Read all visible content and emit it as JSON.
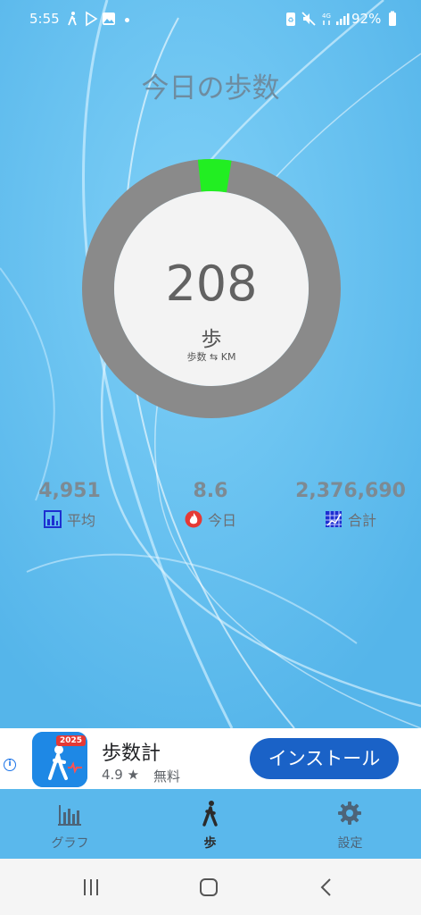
{
  "status_bar": {
    "time": "5:55",
    "battery": "92%",
    "icons": [
      "walk-icon",
      "play-store-icon",
      "gallery-icon",
      "battery-saver-icon",
      "mute-icon",
      "4g-icon",
      "signal-icon",
      "battery-icon"
    ]
  },
  "header": {
    "title": "今日の歩数"
  },
  "ring": {
    "steps": "208",
    "unit": "歩",
    "toggle": "歩数 ⇆ KM",
    "progress_fraction": 0.0416,
    "colors": {
      "track": "#8a8a8a",
      "progress": "#22ee22",
      "inner": "#f3f3f3"
    }
  },
  "stats": [
    {
      "value": "4,951",
      "label": "平均",
      "icon": "average-chart-icon"
    },
    {
      "value": "8.6",
      "label": "今日",
      "icon": "fire-icon"
    },
    {
      "value": "2,376,690",
      "label": "合計",
      "icon": "total-grid-icon"
    }
  ],
  "ad": {
    "app_name": "歩数計",
    "rating": "4.9 ★",
    "price": "無料",
    "badge": "2025",
    "install_label": "インストール"
  },
  "bottom_nav": [
    {
      "label": "グラフ",
      "icon": "bar-chart-icon",
      "active": false
    },
    {
      "label": "歩",
      "icon": "walking-person-icon",
      "active": true
    },
    {
      "label": "設定",
      "icon": "gear-icon",
      "active": false
    }
  ],
  "colors": {
    "background": "#5ab8ec",
    "install_button": "#1a62c7",
    "stat_value": "#7d8a93"
  }
}
